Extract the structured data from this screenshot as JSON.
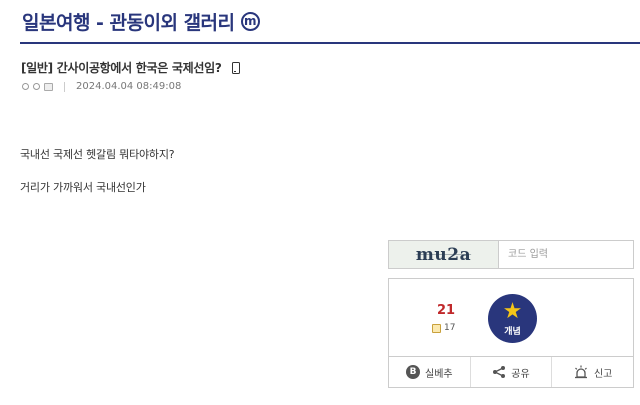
{
  "header": {
    "gallery_title": "일본여행 - 관동이외 갤러리",
    "badge": "m"
  },
  "post": {
    "title": "[일반] 간사이공항에서 한국은 국제선임?",
    "datetime": "2024.04.04 08:49:08",
    "content_lines": [
      "국내선 국제선 헷갈림 뭐타야하지?",
      "거리가 가까워서 국내선인가"
    ]
  },
  "captcha": {
    "image_text": "mu2a",
    "placeholder": "코드 입력"
  },
  "recommend": {
    "count": "21",
    "fixed_count": "17",
    "button_label": "개념"
  },
  "actions": {
    "silbe_label": "실베추",
    "share_label": "공유",
    "report_label": "신고"
  },
  "colors": {
    "brand": "#29367c",
    "recommend_count": "#c0292b",
    "star": "#f5c518"
  }
}
